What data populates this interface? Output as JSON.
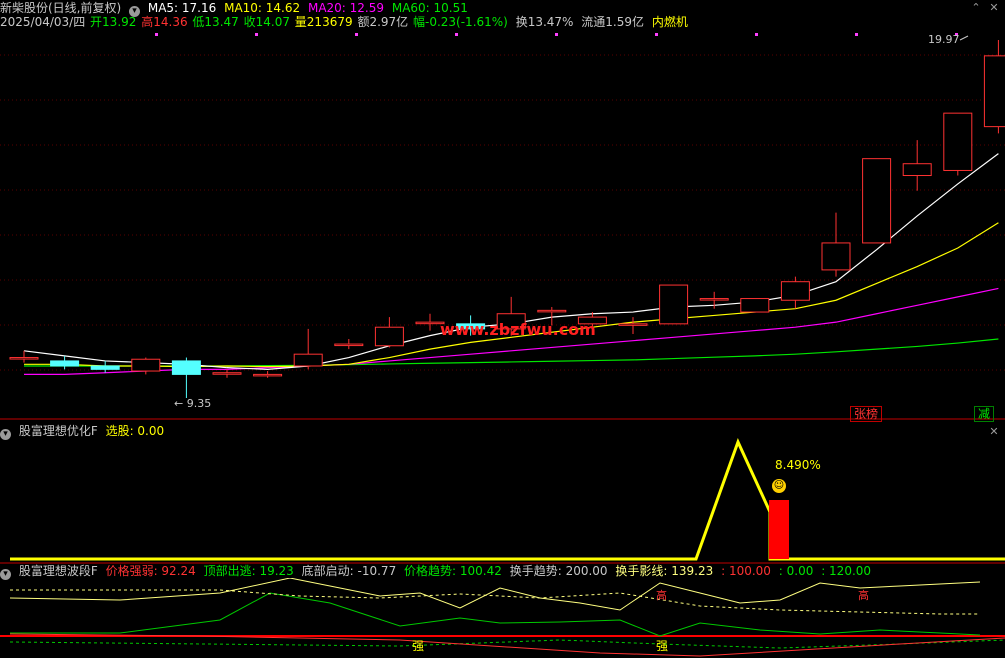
{
  "main_panel": {
    "stock_name": "新柴股份(日线,前复权)",
    "ma5_label": "MA5: 17.16",
    "ma10_label": "MA10: 14.62",
    "ma20_label": "MA20: 12.59",
    "ma60_label": "MA60: 10.51",
    "date": "2025/04/03/四",
    "open_label": "开13.92",
    "high_label": "高14.36",
    "low_label": "低13.47",
    "close_label": "收14.07",
    "volume_label": "量213679",
    "amount_label": "额2.97亿",
    "change_label": "幅-0.23(-1.61%)",
    "turnover_label": "换13.47%",
    "float_label": "流通1.59亿",
    "sector_label": "内燃机",
    "high_price_label": "19.97",
    "low_price_label": "9.35",
    "tag_limit": "张榜",
    "tag_reduce": "减",
    "watermark": "www.zbzfwu.com"
  },
  "indicator1": {
    "title": "股富理想优化F",
    "select_label": "选股: 0.00",
    "percent_label": "8.490%"
  },
  "indicator2": {
    "title": "股富理想波段F",
    "v1": "价格强弱: 92.24",
    "v2": "顶部出逃: 19.23",
    "v3": "底部启动: -10.77",
    "v4": "价格趋势: 100.42",
    "v5": "换手趋势: 200.00",
    "v6": "换手影线: 139.23",
    "v7": ": 100.00",
    "v8": ": 0.00",
    "v9": ": 120.00",
    "mark_top1": "高",
    "mark_top2": "高",
    "mark_strong1": "强",
    "mark_strong2": "强"
  },
  "colors": {
    "up": "#ff3232",
    "down": "#54ffff",
    "ma5": "#ffffff",
    "ma10": "#ffff00",
    "ma20": "#ff00ff",
    "ma60": "#00e600",
    "panel_line": "#c00000"
  },
  "chart_data": {
    "type": "candlestick",
    "ylim": [
      9.35,
      19.97
    ],
    "candles": [
      {
        "o": 10.55,
        "c": 10.55,
        "h": 10.75,
        "l": 10.4
      },
      {
        "o": 10.45,
        "c": 10.3,
        "h": 10.6,
        "l": 10.2
      },
      {
        "o": 10.3,
        "c": 10.2,
        "h": 10.45,
        "l": 10.1
      },
      {
        "o": 10.15,
        "c": 10.5,
        "h": 10.55,
        "l": 10.05
      },
      {
        "o": 10.45,
        "c": 10.05,
        "h": 10.55,
        "l": 9.35
      },
      {
        "o": 10.1,
        "c": 10.1,
        "h": 10.2,
        "l": 9.95
      },
      {
        "o": 10.05,
        "c": 10.05,
        "h": 10.15,
        "l": 9.95
      },
      {
        "o": 10.3,
        "c": 10.65,
        "h": 11.4,
        "l": 10.2
      },
      {
        "o": 10.95,
        "c": 10.95,
        "h": 11.1,
        "l": 10.8
      },
      {
        "o": 10.9,
        "c": 11.45,
        "h": 11.75,
        "l": 10.85
      },
      {
        "o": 11.6,
        "c": 11.6,
        "h": 11.85,
        "l": 11.35
      },
      {
        "o": 11.55,
        "c": 11.4,
        "h": 11.8,
        "l": 11.2
      },
      {
        "o": 11.4,
        "c": 11.85,
        "h": 12.35,
        "l": 11.2
      },
      {
        "o": 11.95,
        "c": 11.95,
        "h": 12.05,
        "l": 11.5
      },
      {
        "o": 11.55,
        "c": 11.75,
        "h": 11.9,
        "l": 11.4
      },
      {
        "o": 11.55,
        "c": 11.55,
        "h": 11.75,
        "l": 11.25
      },
      {
        "o": 11.55,
        "c": 12.7,
        "h": 12.7,
        "l": 11.55
      },
      {
        "o": 12.3,
        "c": 12.3,
        "h": 12.5,
        "l": 12.0
      },
      {
        "o": 11.9,
        "c": 12.3,
        "h": 12.3,
        "l": 11.9
      },
      {
        "o": 12.25,
        "c": 12.8,
        "h": 12.95,
        "l": 12.0
      },
      {
        "o": 13.15,
        "c": 13.95,
        "h": 14.85,
        "l": 12.95
      },
      {
        "o": 13.95,
        "c": 16.45,
        "h": 16.45,
        "l": 13.95
      },
      {
        "o": 15.95,
        "c": 16.3,
        "h": 17.0,
        "l": 15.5
      },
      {
        "o": 16.1,
        "c": 17.8,
        "h": 17.8,
        "l": 15.95
      },
      {
        "o": 17.4,
        "c": 19.5,
        "h": 19.97,
        "l": 17.2
      }
    ],
    "ma5": [
      10.75,
      10.6,
      10.45,
      10.4,
      10.35,
      10.25,
      10.2,
      10.3,
      10.55,
      10.9,
      11.2,
      11.45,
      11.55,
      11.75,
      11.85,
      11.9,
      12.05,
      12.1,
      12.2,
      12.4,
      12.8,
      13.75,
      14.75,
      15.7,
      16.6
    ],
    "ma10": [
      10.35,
      10.35,
      10.3,
      10.3,
      10.28,
      10.3,
      10.28,
      10.3,
      10.35,
      10.55,
      10.8,
      11.0,
      11.15,
      11.3,
      11.45,
      11.6,
      11.7,
      11.8,
      11.9,
      12.0,
      12.25,
      12.75,
      13.25,
      13.8,
      14.55
    ],
    "ma20": [
      10.05,
      10.05,
      10.1,
      10.15,
      10.2,
      10.2,
      10.25,
      10.3,
      10.35,
      10.45,
      10.55,
      10.65,
      10.75,
      10.85,
      10.95,
      11.05,
      11.15,
      11.25,
      11.35,
      11.45,
      11.6,
      11.85,
      12.1,
      12.35,
      12.6
    ],
    "ma60": [
      10.3,
      10.3,
      10.3,
      10.3,
      10.3,
      10.3,
      10.31,
      10.32,
      10.34,
      10.36,
      10.38,
      10.4,
      10.42,
      10.44,
      10.46,
      10.48,
      10.52,
      10.56,
      10.6,
      10.65,
      10.72,
      10.8,
      10.88,
      10.98,
      11.1
    ]
  }
}
